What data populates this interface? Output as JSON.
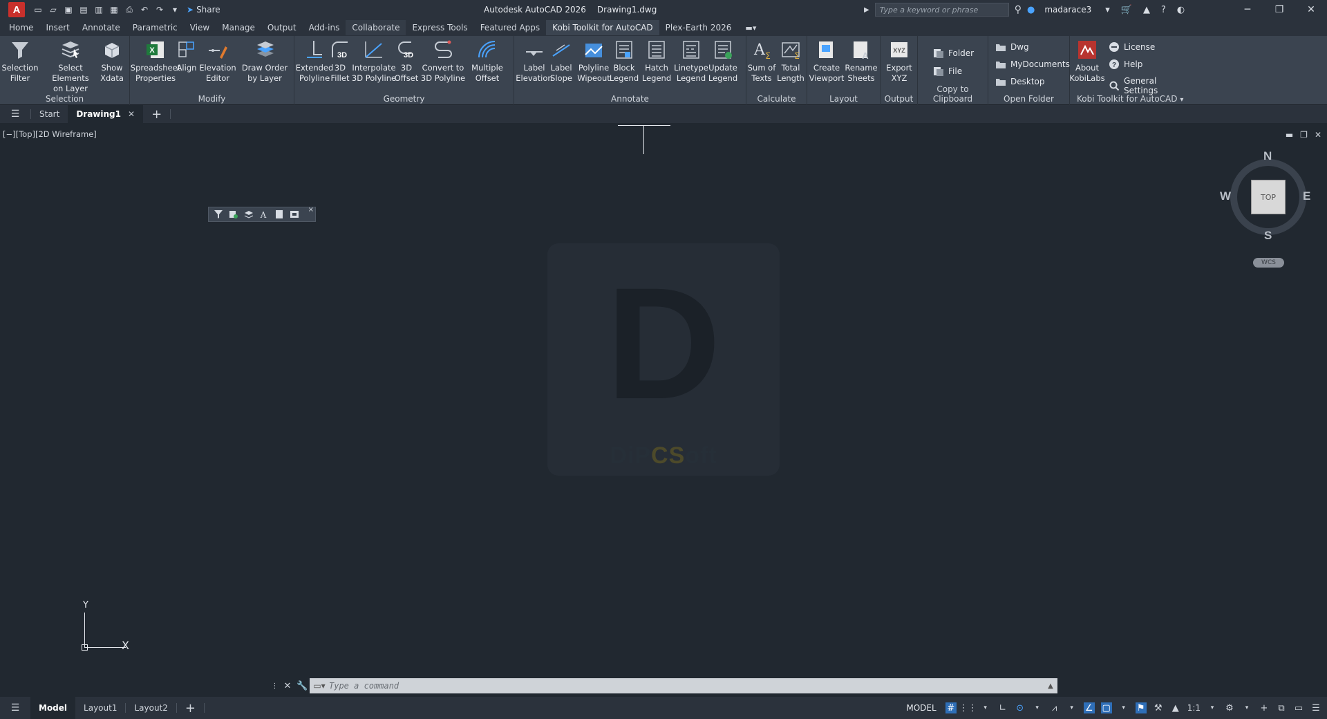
{
  "colors": {
    "accent": "#2f6fb8",
    "app_logo": "#c9302c",
    "canvas": "#212830",
    "ribbon": "#3b4450"
  },
  "titlebar": {
    "app_logo": "A",
    "share_label": "Share",
    "app_name": "Autodesk AutoCAD 2026",
    "file_name": "Drawing1.dwg",
    "search_placeholder": "Type a keyword or phrase",
    "user_name": "madarace3"
  },
  "ribbon_tabs": [
    "Home",
    "Insert",
    "Annotate",
    "Parametric",
    "View",
    "Manage",
    "Output",
    "Add-ins",
    "Collaborate",
    "Express Tools",
    "Featured Apps",
    "Kobi Toolkit for AutoCAD",
    "Plex-Earth 2026"
  ],
  "ribbon": {
    "groups": {
      "selection": "Selection",
      "modify": "Modify",
      "geometry": "Geometry",
      "annotate": "Annotate",
      "calculate": "Calculate",
      "layout": "Layout",
      "output": "Output",
      "copy": "Copy to Clipboard",
      "open_folder": "Open Folder",
      "kobi": "Kobi Toolkit for AutoCAD"
    },
    "buttons": {
      "selection_filter": "Selection\nFilter",
      "select_on_layer": "Select Elements\non Layer",
      "show_xdata": "Show\nXdata",
      "spreadsheet": "Spreadsheet\nProperties",
      "align": "Align",
      "elevation_editor": "Elevation\nEditor",
      "draw_order": "Draw Order\nby Layer",
      "extended_polyline": "Extended\nPolyline",
      "fillet_3d": "3D\nFillet",
      "interpolate": "Interpolate\n3D Polyline",
      "offset_3d": "3D\nOffset",
      "convert_3d": "Convert to\n3D Polyline",
      "multiple_offset": "Multiple\nOffset",
      "label_elevation": "Label\nElevation",
      "label_slope": "Label\nSlope",
      "polyline_wipeout": "Polyline\nWipeout",
      "block_legend": "Block\nLegend",
      "hatch_legend": "Hatch\nLegend",
      "linetype_legend": "Linetype\nLegend",
      "update_legend": "Update\nLegend",
      "sum_texts": "Sum of\nTexts",
      "total_length": "Total\nLength",
      "create_viewport": "Create\nViewport",
      "rename_sheets": "Rename\nSheets",
      "export_xyz": "Export\nXYZ",
      "folder": "Folder",
      "file": "File",
      "dwg": "Dwg",
      "mydocuments": "MyDocuments",
      "desktop": "Desktop",
      "about": "About\nKobiLabs",
      "license": "License",
      "help": "Help",
      "general_settings": "General Settings"
    }
  },
  "doc_tabs": {
    "start": "Start",
    "drawing": "Drawing1"
  },
  "viewport": {
    "label": "[−][Top][2D Wireframe]",
    "viewcube": {
      "top": "TOP",
      "n": "N",
      "s": "S",
      "e": "E",
      "w": "W",
      "wcs": "WCS"
    },
    "ucs": {
      "x": "X",
      "y": "Y"
    },
    "watermark": {
      "letter": "D",
      "text_a": "DiP",
      "text_b": "CS",
      "text_c": "oft"
    }
  },
  "command": {
    "placeholder": "Type a command"
  },
  "layout_tabs": [
    "Model",
    "Layout1",
    "Layout2"
  ],
  "status": {
    "mode": "MODEL",
    "scale": "1:1"
  }
}
